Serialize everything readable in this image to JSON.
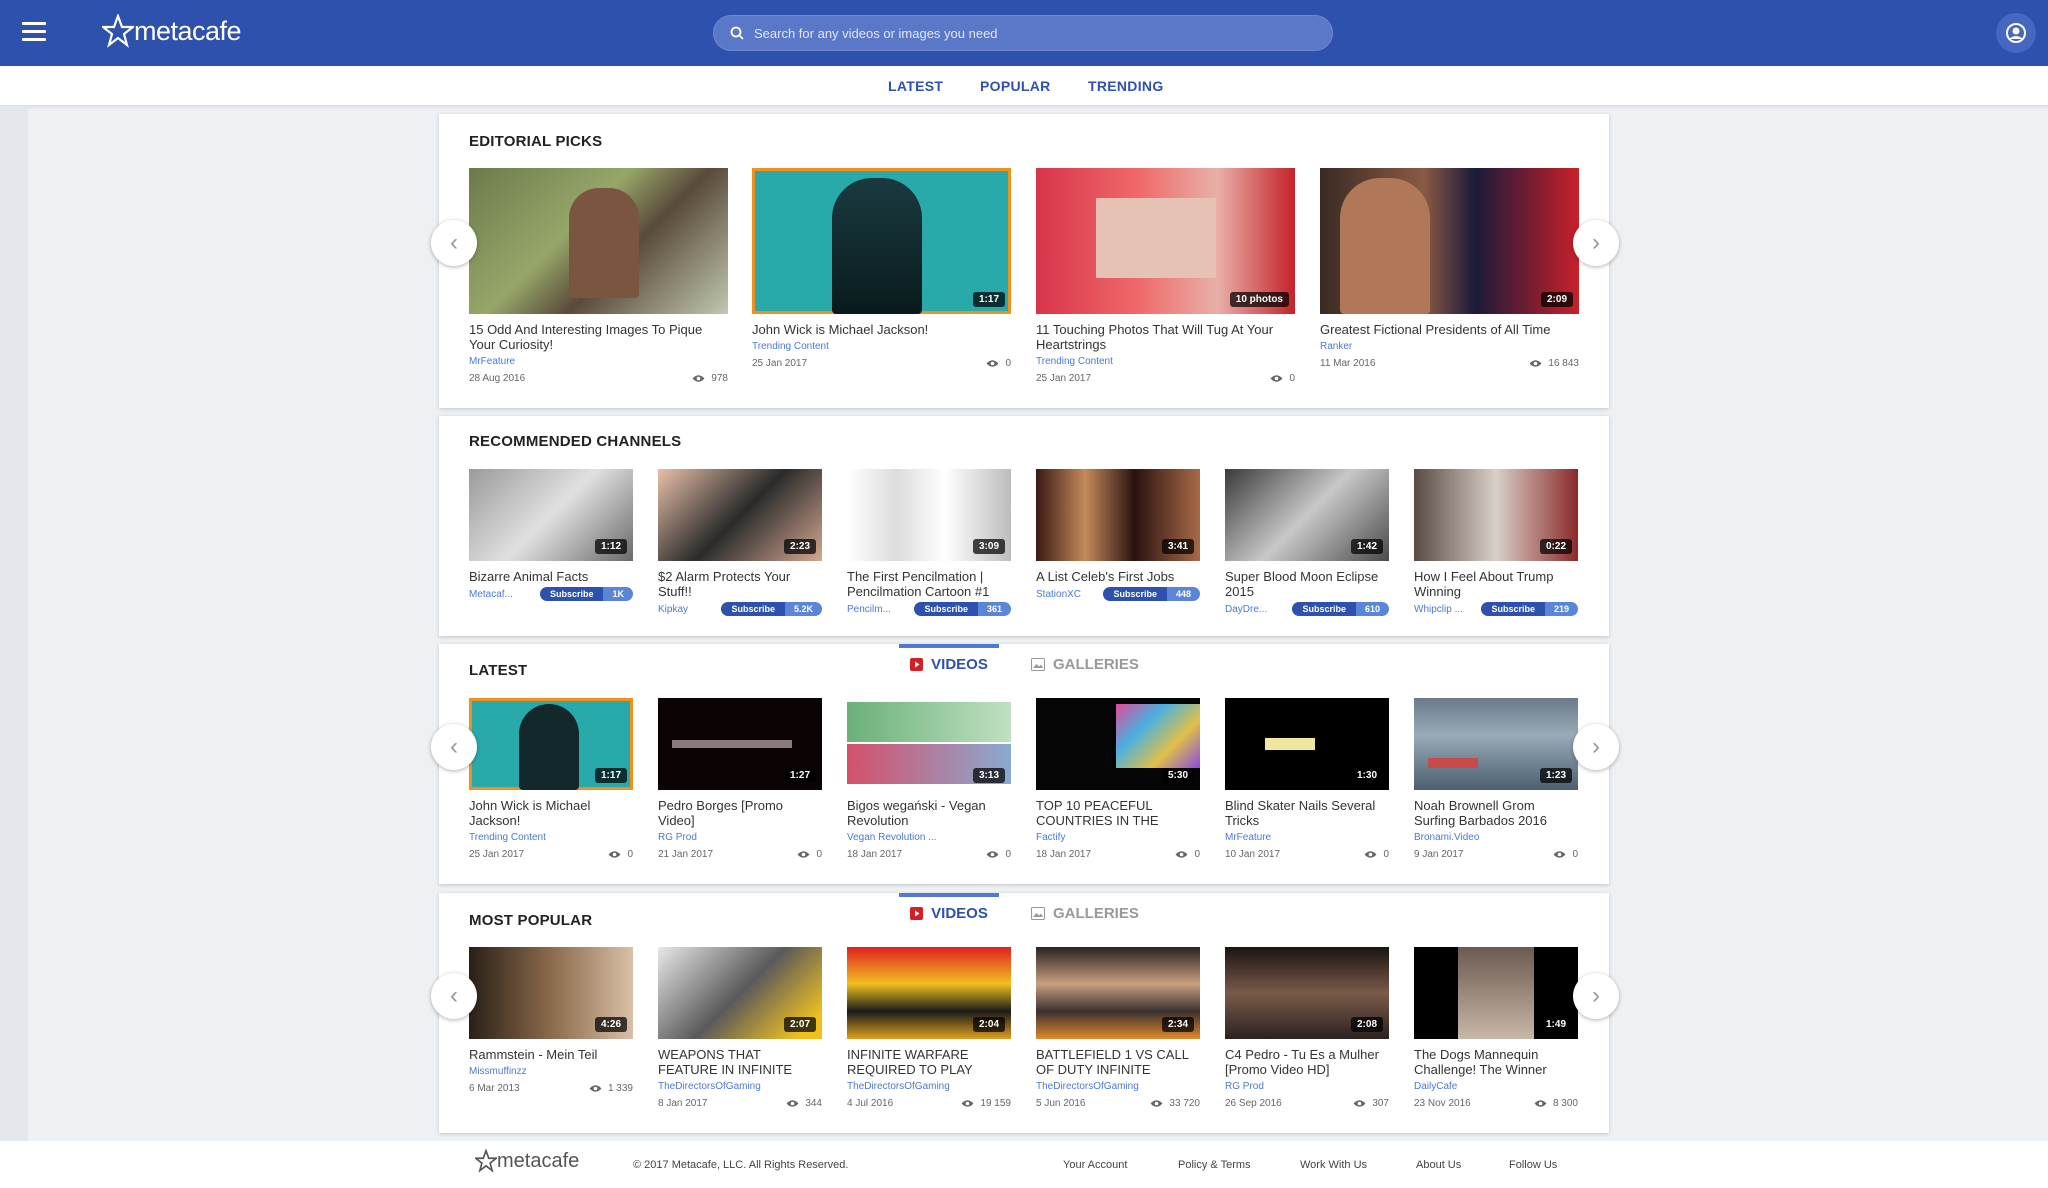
{
  "brand": {
    "name": "metacafe"
  },
  "search": {
    "placeholder": "Search for any videos or images you need"
  },
  "nav": {
    "tabs": [
      "LATEST",
      "POPULAR",
      "TRENDING"
    ]
  },
  "editorial": {
    "title": "EDITORIAL PICKS",
    "cards": [
      {
        "title": "15 Odd And Interesting Images To Pique Your Curiosity!",
        "channel": "MrFeature",
        "date": "28 Aug 2016",
        "views": "978",
        "duration": ""
      },
      {
        "title": "John Wick is Michael Jackson!",
        "channel": "Trending Content",
        "date": "25 Jan 2017",
        "views": "0",
        "duration": "1:17"
      },
      {
        "title": "11 Touching Photos That Will Tug At Your Heartstrings",
        "channel": "Trending Content",
        "date": "25 Jan 2017",
        "views": "0",
        "duration": "10 photos"
      },
      {
        "title": "Greatest Fictional Presidents of All Time",
        "channel": "Ranker",
        "date": "11 Mar 2016",
        "views": "16 843",
        "duration": "2:09"
      }
    ]
  },
  "channels": {
    "title": "RECOMMENDED CHANNELS",
    "subscribe_label": "Subscribe",
    "cards": [
      {
        "title": "Bizarre Animal Facts",
        "channel": "Metacaf...",
        "subs": "1K",
        "duration": "1:12"
      },
      {
        "title": "$2 Alarm Protects Your Stuff!!",
        "channel": "Kipkay",
        "subs": "5.2K",
        "duration": "2:23"
      },
      {
        "title": "The First Pencilmation | Pencilmation Cartoon #1",
        "channel": "Pencilm...",
        "subs": "361",
        "duration": "3:09"
      },
      {
        "title": "A List Celeb's First Jobs",
        "channel": "StationXC",
        "subs": "448",
        "duration": "3:41"
      },
      {
        "title": "Super Blood Moon Eclipse 2015",
        "channel": "DayDre...",
        "subs": "610",
        "duration": "1:42"
      },
      {
        "title": "How I Feel About Trump Winning",
        "channel": "Whipclip ...",
        "subs": "219",
        "duration": "0:22"
      }
    ]
  },
  "latest": {
    "title": "LATEST",
    "tab_videos": "VIDEOS",
    "tab_galleries": "GALLERIES",
    "cards": [
      {
        "title": "John Wick is Michael Jackson!",
        "channel": "Trending Content",
        "date": "25 Jan 2017",
        "views": "0",
        "duration": "1:17"
      },
      {
        "title": "Pedro Borges [Promo Video]",
        "channel": "RG Prod",
        "date": "21 Jan 2017",
        "views": "0",
        "duration": "1:27"
      },
      {
        "title": "Bigos wegański - Vegan Revolution",
        "channel": "Vegan Revolution ...",
        "date": "18 Jan 2017",
        "views": "0",
        "duration": "3:13"
      },
      {
        "title": "TOP 10 PEACEFUL COUNTRIES IN THE",
        "channel": "Factify",
        "date": "18 Jan 2017",
        "views": "0",
        "duration": "5:30"
      },
      {
        "title": "Blind Skater Nails Several Tricks",
        "channel": "MrFeature",
        "date": "10 Jan 2017",
        "views": "0",
        "duration": "1:30"
      },
      {
        "title": "Noah Brownell Grom Surfing Barbados 2016",
        "channel": "Bronami.Video",
        "date": "9 Jan 2017",
        "views": "0",
        "duration": "1:23"
      }
    ]
  },
  "popular": {
    "title": "MOST POPULAR",
    "tab_videos": "VIDEOS",
    "tab_galleries": "GALLERIES",
    "cards": [
      {
        "title": "Rammstein - Mein Teil",
        "channel": "Missmuffinzz",
        "date": "6 Mar 2013",
        "views": "1 339",
        "duration": "4:26"
      },
      {
        "title": "WEAPONS THAT FEATURE IN INFINITE",
        "channel": "TheDirectorsOfGaming",
        "date": "8 Jan 2017",
        "views": "344",
        "duration": "2:07"
      },
      {
        "title": "INFINITE WARFARE REQUIRED TO PLAY",
        "channel": "TheDirectorsOfGaming",
        "date": "4 Jul 2016",
        "views": "19 159",
        "duration": "2:04"
      },
      {
        "title": "BATTLEFIELD 1 VS CALL OF DUTY INFINITE",
        "channel": "TheDirectorsOfGaming",
        "date": "5 Jun 2016",
        "views": "33 720",
        "duration": "2:34"
      },
      {
        "title": "C4 Pedro - Tu Es a Mulher [Promo Video HD]",
        "channel": "RG Prod",
        "date": "26 Sep 2016",
        "views": "307",
        "duration": "2:08"
      },
      {
        "title": "The Dogs Mannequin Challenge! The Winner",
        "channel": "DailyCafe",
        "date": "23 Nov 2016",
        "views": "8 300",
        "duration": "1:49"
      }
    ]
  },
  "footer": {
    "copyright": "© 2017 Metacafe, LLC. All Rights Reserved.",
    "links": [
      "Your Account",
      "Policy & Terms",
      "Work With Us",
      "About Us",
      "Follow Us"
    ]
  },
  "colors": {
    "brand_blue": "#2e51ad",
    "link_blue": "#4b78d6",
    "highlight_orange": "#f0901e"
  }
}
